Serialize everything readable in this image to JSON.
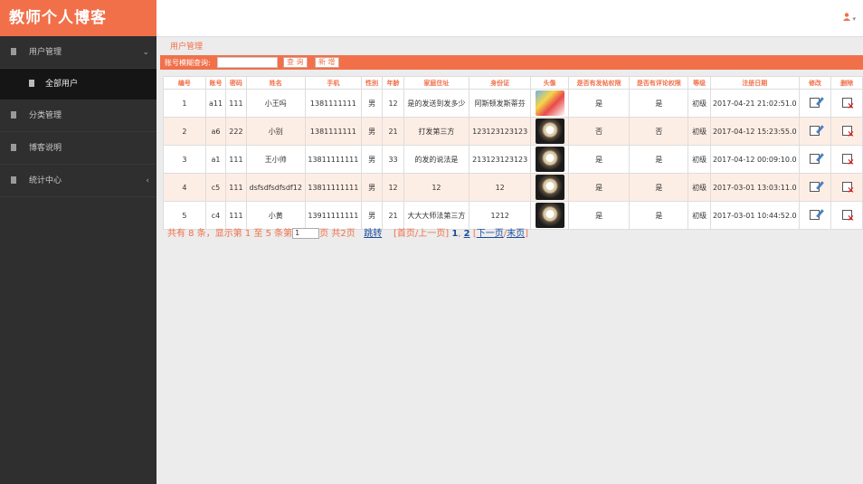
{
  "app": {
    "title": "教师个人博客"
  },
  "sidebar": {
    "items": [
      {
        "label": "用户管理",
        "chevron": "⌄"
      },
      {
        "label": "全部用户"
      },
      {
        "label": "分类管理"
      },
      {
        "label": "博客说明"
      },
      {
        "label": "统计中心",
        "chevron": "‹"
      }
    ]
  },
  "header": {
    "user_icon": "user-icon",
    "caret": "▾"
  },
  "main": {
    "title": "用户管理",
    "search": {
      "label": "账号模糊查询:",
      "value": "",
      "query_button": "查 询",
      "add_button": "新 增"
    },
    "columns": [
      "编号",
      "账号",
      "密码",
      "姓名",
      "手机",
      "性别",
      "年龄",
      "家庭住址",
      "身份证",
      "头像",
      "是否有发帖权限",
      "是否有评论权限",
      "等级",
      "注册日期",
      "修改",
      "删除"
    ],
    "rows": [
      {
        "id": "1",
        "account": "a11",
        "password": "111",
        "name": "小王吗",
        "phone": "1381111111",
        "gender": "男",
        "age": "12",
        "address": "是的发送到发多少",
        "idcard": "阿斯顿发斯蒂芬",
        "avatar": "cartoon",
        "post_perm": "是",
        "comment_perm": "是",
        "level": "初级",
        "date": "2017-04-21 21:02:51.0"
      },
      {
        "id": "2",
        "account": "a6",
        "password": "222",
        "name": "小别",
        "phone": "1381111111",
        "gender": "男",
        "age": "21",
        "address": "打发第三方",
        "idcard": "123123123123",
        "avatar": "dark",
        "post_perm": "否",
        "comment_perm": "否",
        "level": "初级",
        "date": "2017-04-12 15:23:55.0"
      },
      {
        "id": "3",
        "account": "a1",
        "password": "111",
        "name": "王小帅",
        "phone": "13811111111",
        "gender": "男",
        "age": "33",
        "address": "的发的说法是",
        "idcard": "213123123123",
        "avatar": "dark",
        "post_perm": "是",
        "comment_perm": "是",
        "level": "初级",
        "date": "2017-04-12 00:09:10.0"
      },
      {
        "id": "4",
        "account": "c5",
        "password": "111",
        "name": "dsfsdfsdfsdf12",
        "phone": "13811111111",
        "gender": "男",
        "age": "12",
        "address": "12",
        "idcard": "12",
        "avatar": "dark",
        "post_perm": "是",
        "comment_perm": "是",
        "level": "初级",
        "date": "2017-03-01 13:03:11.0"
      },
      {
        "id": "5",
        "account": "c4",
        "password": "111",
        "name": "小黄",
        "phone": "13911111111",
        "gender": "男",
        "age": "21",
        "address": "大大大师法第三方",
        "idcard": "1212",
        "avatar": "dark",
        "post_perm": "是",
        "comment_perm": "是",
        "level": "初级",
        "date": "2017-03-01 10:44:52.0"
      }
    ]
  },
  "pager": {
    "summary": "共有 8 条，显示第 1 至 5 条第",
    "page_input": "1",
    "of": "页 共2页",
    "jump": "跳转",
    "first_prev": "[首页/上一页]",
    "page1": "1",
    "page2": "2",
    "next": "下一页",
    "last": "末页"
  },
  "colors": {
    "accent": "#f1704a",
    "sidebar_bg": "#2f2f2f",
    "row_alt": "#fdeee5"
  }
}
